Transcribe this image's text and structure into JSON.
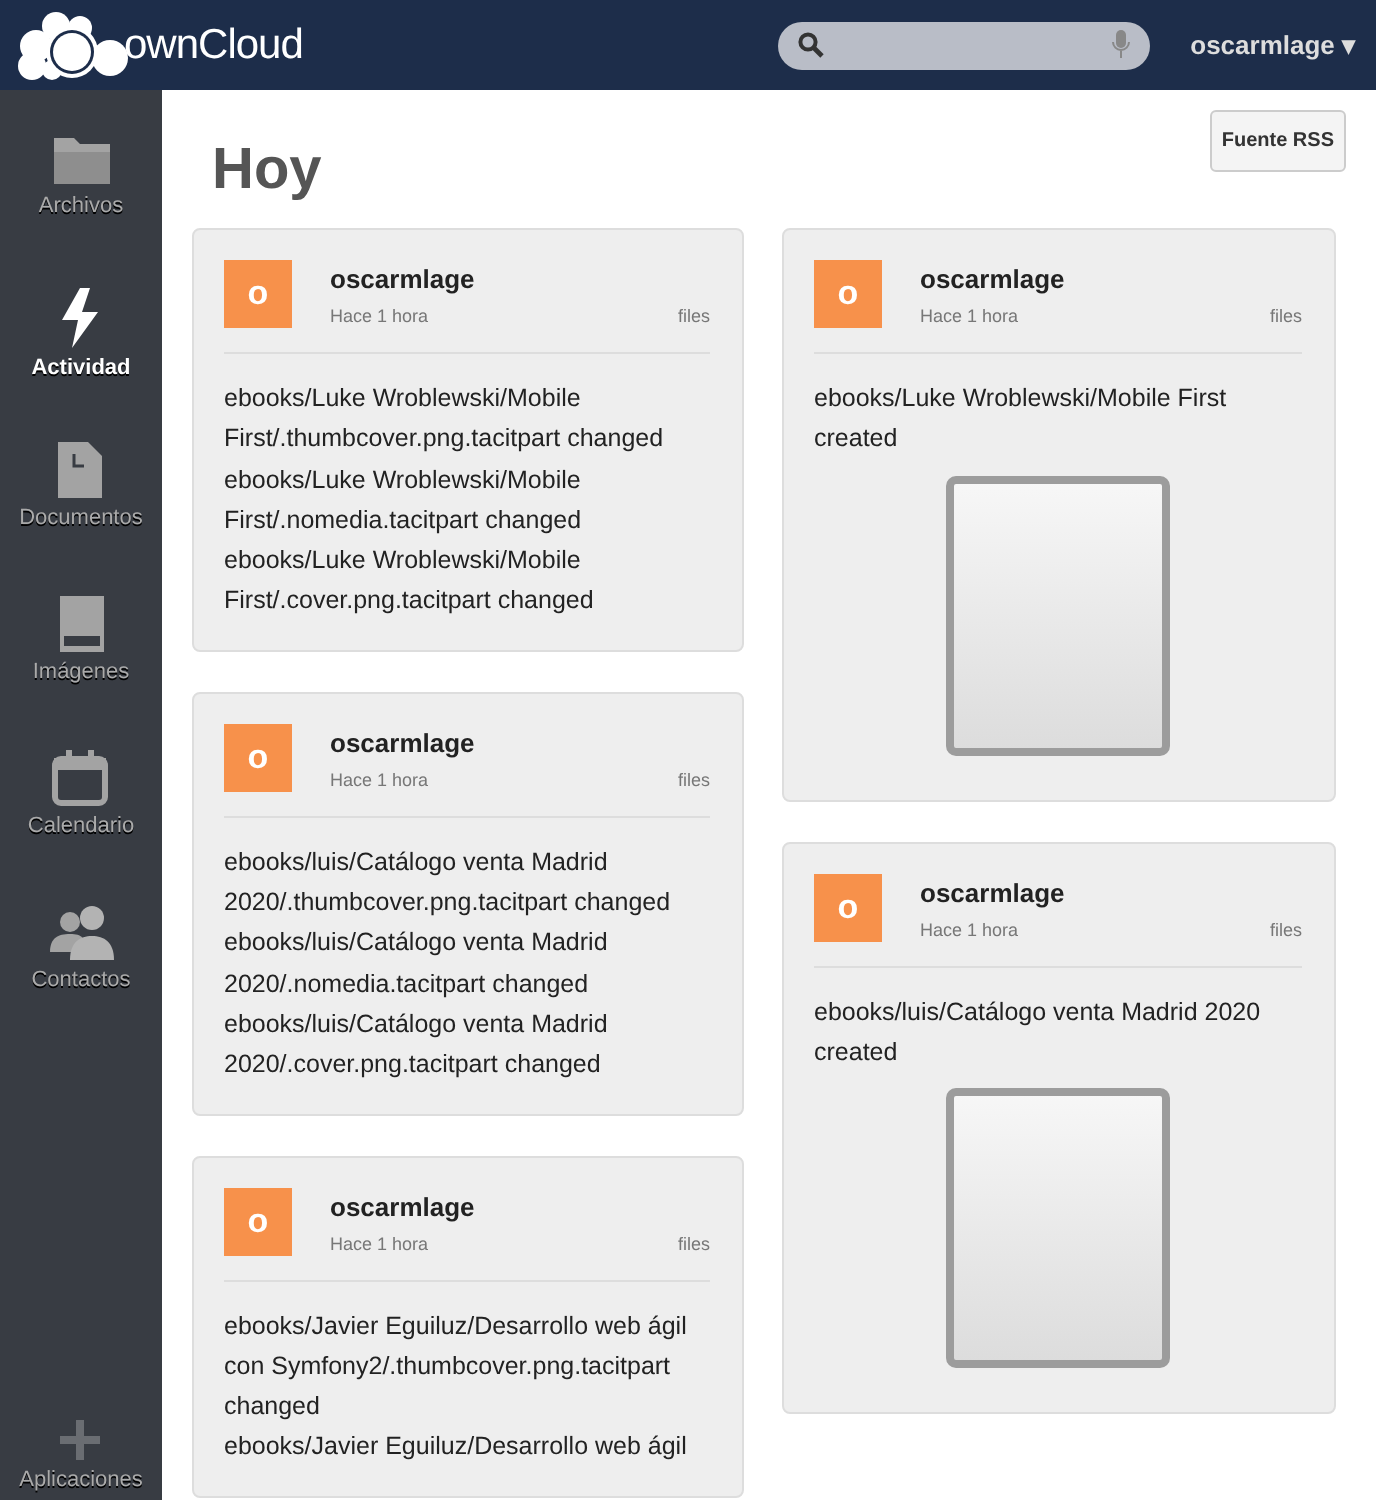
{
  "header": {
    "logo": "ownCloud",
    "user": "oscarmlage ▾"
  },
  "sidebar": {
    "items": [
      {
        "label": "Archivos",
        "selected": false
      },
      {
        "label": "Actividad",
        "selected": true
      },
      {
        "label": "Documentos",
        "selected": false
      },
      {
        "label": "Imágenes",
        "selected": false
      },
      {
        "label": "Calendario",
        "selected": false
      },
      {
        "label": "Contactos",
        "selected": false
      }
    ],
    "footer": {
      "label": "Aplicaciones"
    }
  },
  "main": {
    "title": "Hoy",
    "rss_button": "Fuente RSS",
    "columns": [
      [
        {
          "avatar": "o",
          "user": "oscarmlage",
          "time": "Hace 1 hora",
          "app": "files",
          "events": [
            "ebooks/Luke Wroblewski/Mobile First/.thumbcover.png.tacitpart changed",
            "ebooks/Luke Wroblewski/Mobile First/.nomedia.tacitpart changed",
            "ebooks/Luke Wroblewski/Mobile First/.cover.png.tacitpart changed"
          ],
          "preview": false
        },
        {
          "avatar": "o",
          "user": "oscarmlage",
          "time": "Hace 1 hora",
          "app": "files",
          "events": [
            "ebooks/luis/Catálogo venta Madrid 2020/.thumbcover.png.tacitpart changed",
            "ebooks/luis/Catálogo venta Madrid 2020/.nomedia.tacitpart changed",
            "ebooks/luis/Catálogo venta Madrid 2020/.cover.png.tacitpart changed"
          ],
          "preview": false
        },
        {
          "avatar": "o",
          "user": "oscarmlage",
          "time": "Hace 1 hora",
          "app": "files",
          "events": [
            "ebooks/Javier Eguiluz/Desarrollo web ágil con Symfony2/.thumbcover.png.tacitpart changed",
            "ebooks/Javier Eguiluz/Desarrollo web ágil"
          ],
          "preview": false
        }
      ],
      [
        {
          "avatar": "o",
          "user": "oscarmlage",
          "time": "Hace 1 hora",
          "app": "files",
          "events": [
            "ebooks/Luke Wroblewski/Mobile First created"
          ],
          "preview": true
        },
        {
          "avatar": "o",
          "user": "oscarmlage",
          "time": "Hace 1 hora",
          "app": "files",
          "events": [
            "ebooks/luis/Catálogo venta Madrid 2020 created"
          ],
          "preview": true
        }
      ]
    ]
  }
}
